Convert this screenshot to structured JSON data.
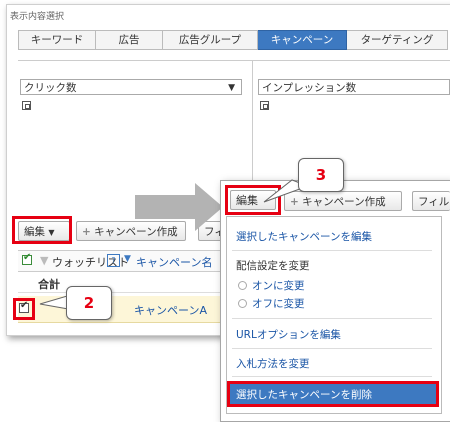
{
  "section_label": "表示内容選択",
  "tabs": [
    {
      "label": "キーワード"
    },
    {
      "label": "広告"
    },
    {
      "label": "広告グループ"
    },
    {
      "label": "キャンペーン"
    },
    {
      "label": "ターゲティング"
    }
  ],
  "active_tab": "キャンペーン",
  "left_dropdown": {
    "value": "クリック数",
    "arrow": "▼"
  },
  "right_dropdown": {
    "value": "インプレッション数"
  },
  "toolbar": {
    "edit_label": "編集",
    "create_campaign_label": "キャンペーン作成",
    "filter_label_partial": "フィ"
  },
  "table": {
    "watchlist_label": "ウォッチリスト",
    "help_icon": "?",
    "campaign_col_partial": "キャンペーン名",
    "total_label": "合計",
    "row_campaign": "キャンペーンA"
  },
  "callouts": {
    "step2": "2",
    "step3": "3"
  },
  "popup": {
    "edit_label": "編集",
    "create_campaign_label": "キャンペーン作成",
    "filter_label_partial": "フィル",
    "menu": {
      "edit_selected": "選択したキャンペーンを編集",
      "delivery_heading": "配信設定を変更",
      "turn_on": "オンに変更",
      "turn_off": "オフに変更",
      "url_options": "URLオプションを編集",
      "bid_method": "入札方法を変更",
      "delete_selected": "選択したキャンペーンを削除"
    }
  },
  "colors": {
    "highlight": "#e60012",
    "accent": "#3d79c1",
    "link": "#1a55a6"
  }
}
